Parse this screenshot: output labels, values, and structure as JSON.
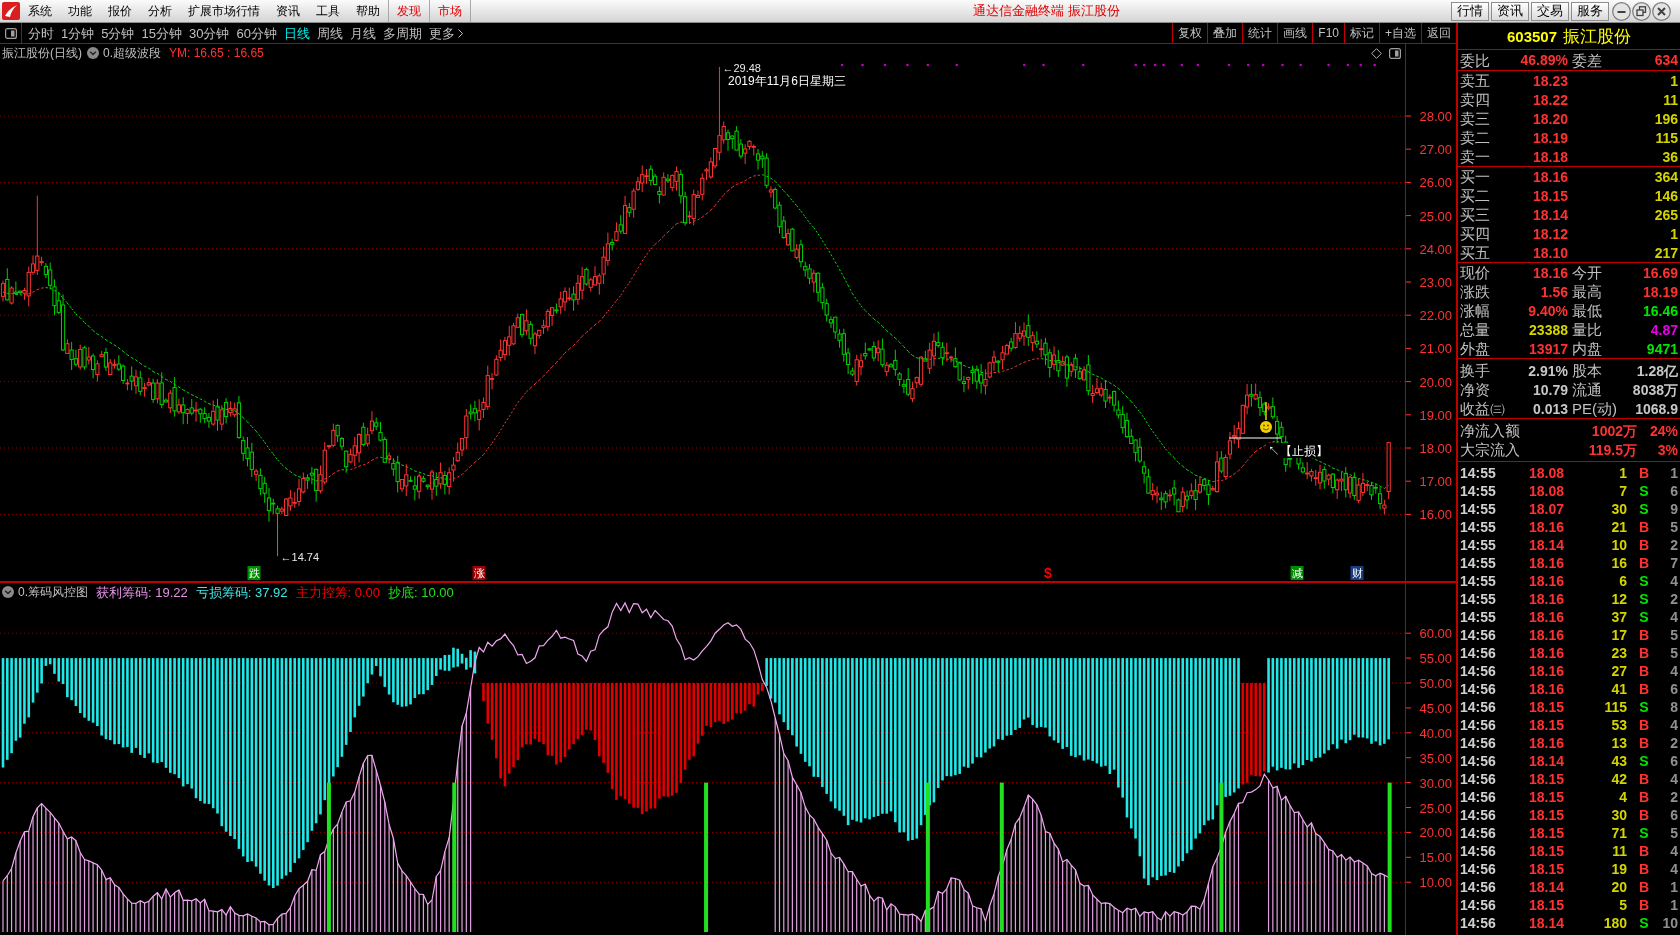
{
  "title_bar": {
    "menu": [
      {
        "label": "系统",
        "kind": "plain"
      },
      {
        "label": "功能",
        "kind": "plain"
      },
      {
        "label": "报价",
        "kind": "plain"
      },
      {
        "label": "分析",
        "kind": "plain"
      },
      {
        "label": "扩展市场行情",
        "kind": "plain"
      },
      {
        "label": "资讯",
        "kind": "plain"
      },
      {
        "label": "工具",
        "kind": "plain"
      },
      {
        "label": "帮助",
        "kind": "plain"
      },
      {
        "label": "发现",
        "kind": "accent"
      },
      {
        "label": "市场",
        "kind": "accent"
      }
    ],
    "title": "通达信金融终端 振江股份",
    "buttons": [
      "行情",
      "资讯",
      "交易",
      "服务"
    ]
  },
  "period_bar": {
    "periods": [
      {
        "label": "分时",
        "selected": false
      },
      {
        "label": "1分钟",
        "selected": false
      },
      {
        "label": "5分钟",
        "selected": false
      },
      {
        "label": "15分钟",
        "selected": false
      },
      {
        "label": "30分钟",
        "selected": false
      },
      {
        "label": "60分钟",
        "selected": false
      },
      {
        "label": "日线",
        "selected": true
      },
      {
        "label": "周线",
        "selected": false
      },
      {
        "label": "月线",
        "selected": false
      },
      {
        "label": "多周期",
        "selected": false
      }
    ],
    "more": "更多"
  },
  "tools": [
    "复权",
    "叠加",
    "统计",
    "画线",
    "F10",
    "标记",
    "+自选",
    "返回"
  ],
  "price_chart": {
    "stock": "振江股份(日线)",
    "indicator": "0.超级波段",
    "readout": "YM: 16.65 : 16.65",
    "high_label": "←29.48",
    "date_label": "2019年11月6日星期三",
    "low_label": "←14.74",
    "stop_label": "↖【止损】",
    "events": [
      {
        "label": "跌",
        "kind": "tag",
        "color": "#008c00"
      },
      {
        "label": "涨",
        "kind": "tag",
        "color": "#a00000"
      },
      {
        "label": "$",
        "kind": "sign",
        "color": "#ff0000"
      },
      {
        "label": "减",
        "kind": "tag",
        "color": "#008c00"
      },
      {
        "label": "财",
        "kind": "tag",
        "color": "#1c3c82"
      }
    ],
    "axis": [
      "28.00",
      "27.00",
      "26.00",
      "25.00",
      "24.00",
      "23.00",
      "22.00",
      "21.00",
      "20.00",
      "19.00",
      "18.00",
      "17.00",
      "16.00"
    ]
  },
  "chip_panel": {
    "indicator": "0.筹码风控图",
    "readouts": [
      {
        "label": "获利筹码: 19.22",
        "color": "#e890e8"
      },
      {
        "label": "亏损筹码: 37.92",
        "color": "#40e8e8"
      },
      {
        "label": "主力控筹: 0.00",
        "color": "#ff0000"
      },
      {
        "label": "抄底: 10.00",
        "color": "#20e020"
      }
    ],
    "axis": [
      "60.00",
      "55.00",
      "50.00",
      "45.00",
      "40.00",
      "35.00",
      "30.00",
      "25.00",
      "20.00",
      "15.00",
      "10.00"
    ]
  },
  "quote_panel": {
    "code": "603507",
    "name": "振江股份",
    "order_ratio": {
      "label": "委比",
      "value": "46.89%",
      "label2": "委差",
      "value2": "634"
    },
    "asks": [
      {
        "label": "卖五",
        "price": "18.23",
        "volume": "1"
      },
      {
        "label": "卖四",
        "price": "18.22",
        "volume": "11"
      },
      {
        "label": "卖三",
        "price": "18.20",
        "volume": "196"
      },
      {
        "label": "卖二",
        "price": "18.19",
        "volume": "115"
      },
      {
        "label": "卖一",
        "price": "18.18",
        "volume": "36"
      }
    ],
    "bids": [
      {
        "label": "买一",
        "price": "18.16",
        "volume": "364"
      },
      {
        "label": "买二",
        "price": "18.15",
        "volume": "146"
      },
      {
        "label": "买三",
        "price": "18.14",
        "volume": "265"
      },
      {
        "label": "买四",
        "price": "18.12",
        "volume": "1"
      },
      {
        "label": "买五",
        "price": "18.10",
        "volume": "217"
      }
    ],
    "stats": [
      {
        "label": "现价",
        "value": "18.16",
        "color": "#ff3232"
      },
      {
        "label": "今开",
        "value": "16.69",
        "color": "#ff3232"
      },
      {
        "label": "涨跌",
        "value": "1.56",
        "color": "#ff3232"
      },
      {
        "label": "最高",
        "value": "18.19",
        "color": "#ff3232"
      },
      {
        "label": "涨幅",
        "value": "9.40%",
        "color": "#ff3232"
      },
      {
        "label": "最低",
        "value": "16.46",
        "color": "#00e600"
      },
      {
        "label": "总量",
        "value": "23388",
        "color": "#d4d400"
      },
      {
        "label": "量比",
        "value": "4.87",
        "color": "#e600e6"
      },
      {
        "label": "外盘",
        "value": "13917",
        "color": "#ff3232"
      },
      {
        "label": "内盘",
        "value": "9471",
        "color": "#00e600"
      }
    ],
    "fundamentals": [
      {
        "label": "换手",
        "value": "2.91%"
      },
      {
        "label": "股本",
        "value": "1.28亿"
      },
      {
        "label": "净资",
        "value": "10.79"
      },
      {
        "label": "流通",
        "value": "8038万"
      },
      {
        "label": "收益㈢",
        "value": "0.013"
      },
      {
        "label": "PE(动)",
        "value": "1068.9"
      }
    ],
    "flows": [
      {
        "label": "净流入额",
        "value": "1002万",
        "share": "24%"
      },
      {
        "label": "大宗流入",
        "value": "119.5万",
        "share": "3%"
      }
    ],
    "trades": [
      {
        "time": "14:55",
        "price": "18.08",
        "volume": "1",
        "side": "B",
        "kind": "buy",
        "count": "1"
      },
      {
        "time": "14:55",
        "price": "18.08",
        "volume": "7",
        "side": "S",
        "kind": "sell",
        "count": "6"
      },
      {
        "time": "14:55",
        "price": "18.07",
        "volume": "30",
        "side": "S",
        "kind": "sell",
        "count": "9"
      },
      {
        "time": "14:55",
        "price": "18.16",
        "volume": "21",
        "side": "B",
        "kind": "buy",
        "count": "5"
      },
      {
        "time": "14:55",
        "price": "18.14",
        "volume": "10",
        "side": "B",
        "kind": "buy",
        "count": "2"
      },
      {
        "time": "14:55",
        "price": "18.16",
        "volume": "16",
        "side": "B",
        "kind": "buy",
        "count": "7"
      },
      {
        "time": "14:55",
        "price": "18.16",
        "volume": "6",
        "side": "S",
        "kind": "sell",
        "count": "4"
      },
      {
        "time": "14:55",
        "price": "18.16",
        "volume": "12",
        "side": "S",
        "kind": "sell",
        "count": "2"
      },
      {
        "time": "14:55",
        "price": "18.16",
        "volume": "37",
        "side": "S",
        "kind": "sell",
        "count": "4"
      },
      {
        "time": "14:56",
        "price": "18.16",
        "volume": "17",
        "side": "B",
        "kind": "buy",
        "count": "5"
      },
      {
        "time": "14:56",
        "price": "18.16",
        "volume": "23",
        "side": "B",
        "kind": "buy",
        "count": "5"
      },
      {
        "time": "14:56",
        "price": "18.16",
        "volume": "27",
        "side": "B",
        "kind": "buy",
        "count": "4"
      },
      {
        "time": "14:56",
        "price": "18.16",
        "volume": "41",
        "side": "B",
        "kind": "buy",
        "count": "6"
      },
      {
        "time": "14:56",
        "price": "18.15",
        "volume": "115",
        "side": "S",
        "kind": "sell",
        "count": "8"
      },
      {
        "time": "14:56",
        "price": "18.15",
        "volume": "53",
        "side": "B",
        "kind": "buy",
        "count": "4"
      },
      {
        "time": "14:56",
        "price": "18.16",
        "volume": "13",
        "side": "B",
        "kind": "buy",
        "count": "2"
      },
      {
        "time": "14:56",
        "price": "18.14",
        "volume": "43",
        "side": "S",
        "kind": "sell",
        "count": "6"
      },
      {
        "time": "14:56",
        "price": "18.15",
        "volume": "42",
        "side": "B",
        "kind": "buy",
        "count": "4"
      },
      {
        "time": "14:56",
        "price": "18.15",
        "volume": "4",
        "side": "B",
        "kind": "buy",
        "count": "2"
      },
      {
        "time": "14:56",
        "price": "18.15",
        "volume": "30",
        "side": "B",
        "kind": "buy",
        "count": "6"
      },
      {
        "time": "14:56",
        "price": "18.15",
        "volume": "71",
        "side": "S",
        "kind": "sell",
        "count": "5"
      },
      {
        "time": "14:56",
        "price": "18.15",
        "volume": "11",
        "side": "B",
        "kind": "buy",
        "count": "4"
      },
      {
        "time": "14:56",
        "price": "18.15",
        "volume": "19",
        "side": "B",
        "kind": "buy",
        "count": "4"
      },
      {
        "time": "14:56",
        "price": "18.14",
        "volume": "20",
        "side": "B",
        "kind": "buy",
        "count": "1"
      },
      {
        "time": "14:56",
        "price": "18.15",
        "volume": "5",
        "side": "B",
        "kind": "buy",
        "count": "1"
      },
      {
        "time": "14:56",
        "price": "18.14",
        "volume": "180",
        "side": "S",
        "kind": "sell",
        "count": "10"
      }
    ]
  }
}
